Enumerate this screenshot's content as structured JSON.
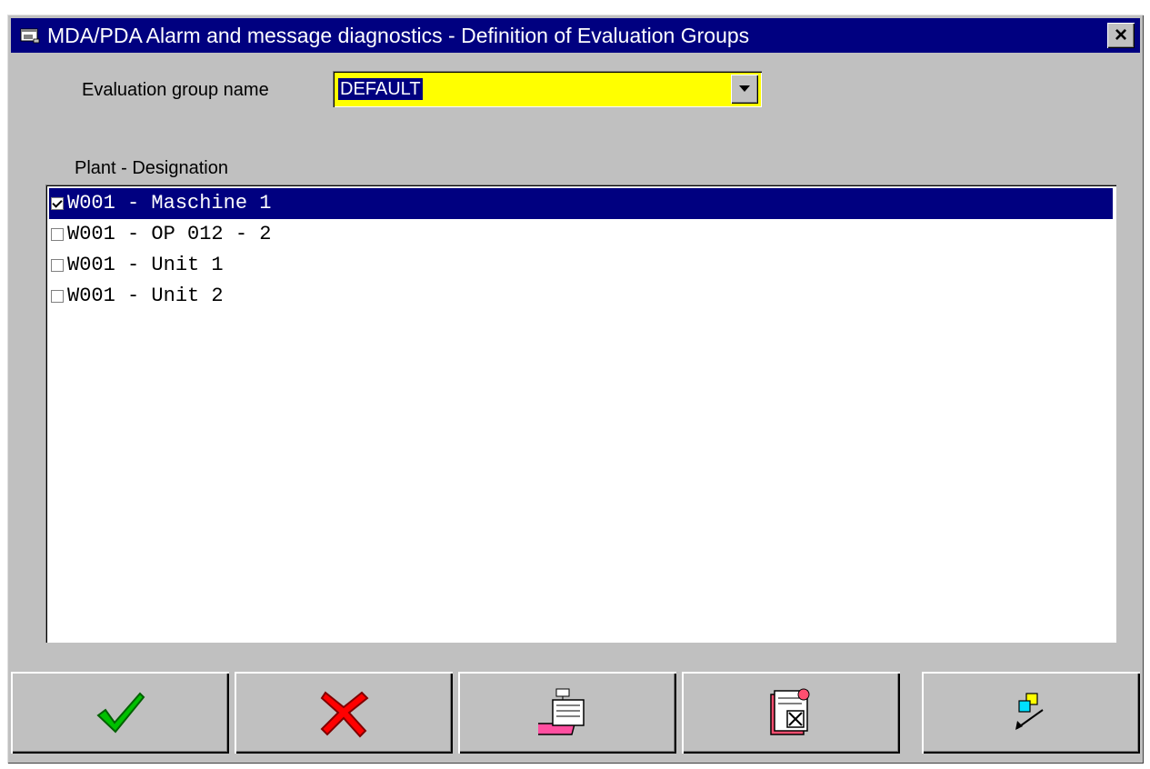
{
  "window": {
    "title": "MDA/PDA Alarm and message diagnostics - Definition of Evaluation Groups",
    "close_glyph": "×",
    "icon": "app-window-icon"
  },
  "group": {
    "label": "Evaluation group name",
    "value": "DEFAULT",
    "field_color": "#ffff00"
  },
  "plant_list": {
    "header": "Plant - Designation",
    "items": [
      {
        "label": "W001 - Maschine 1",
        "checked": true,
        "selected": true
      },
      {
        "label": "W001 - OP 012 - 2",
        "checked": false,
        "selected": false
      },
      {
        "label": "W001 - Unit 1",
        "checked": false,
        "selected": false
      },
      {
        "label": "W001 - Unit 2",
        "checked": false,
        "selected": false
      }
    ]
  },
  "toolbar": {
    "buttons": [
      {
        "icon": "green-checkmark-icon",
        "action": "ok"
      },
      {
        "icon": "red-x-icon",
        "action": "cancel"
      },
      {
        "icon": "add-to-book-icon",
        "action": "new"
      },
      {
        "icon": "delete-from-book-icon",
        "action": "delete"
      },
      {
        "icon": "assign-arrow-icon",
        "action": "assign"
      }
    ]
  },
  "colors": {
    "titlebar": "#000080",
    "selection": "#000080",
    "face": "#c0c0c0"
  }
}
